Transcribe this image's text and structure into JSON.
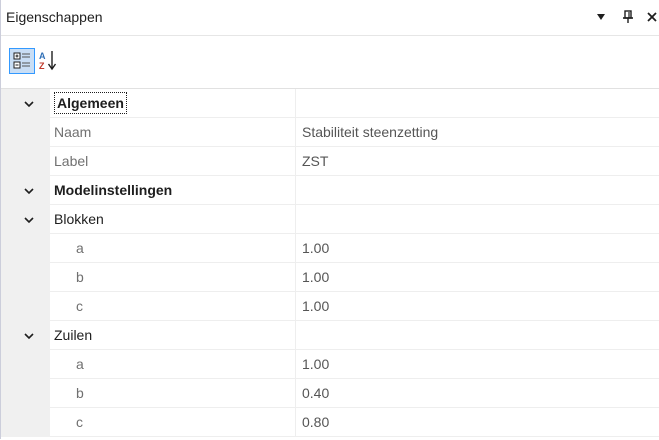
{
  "panel": {
    "title": "Eigenschappen",
    "dropdown_icon": "caret-down-icon",
    "pin_icon": "pin-icon",
    "close_icon": "close-icon"
  },
  "toolbar": {
    "categorized_icon": "categorized-icon",
    "alphabetical_icon": "sort-az-icon"
  },
  "rows": {
    "algemeen": {
      "label": "Algemeen"
    },
    "naam": {
      "label": "Naam",
      "value": "Stabiliteit steenzetting"
    },
    "label": {
      "label": "Label",
      "value": "ZST"
    },
    "modelinstellingen": {
      "label": "Modelinstellingen"
    },
    "blokken": {
      "label": "Blokken"
    },
    "blokken_a": {
      "label": "a",
      "value": "1.00"
    },
    "blokken_b": {
      "label": "b",
      "value": "1.00"
    },
    "blokken_c": {
      "label": "c",
      "value": "1.00"
    },
    "zuilen": {
      "label": "Zuilen"
    },
    "zuilen_a": {
      "label": "a",
      "value": "1.00"
    },
    "zuilen_b": {
      "label": "b",
      "value": "0.40"
    },
    "zuilen_c": {
      "label": "c",
      "value": "0.80"
    }
  }
}
